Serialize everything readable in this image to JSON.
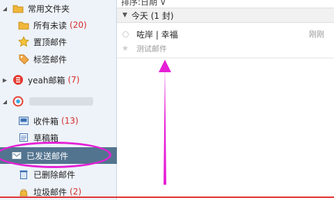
{
  "sidebar": {
    "common_folder": {
      "label": "常用文件夹"
    },
    "all_unread": {
      "label": "所有未读",
      "count": "(20)"
    },
    "pinned": {
      "label": "置顶邮件"
    },
    "tagged": {
      "label": "标签邮件"
    },
    "yeah_account": {
      "label": "yeah邮箱",
      "count": "(7)"
    },
    "account2": {},
    "inbox": {
      "label": "收件箱",
      "count": "(13)"
    },
    "drafts": {
      "label": "草稿箱"
    },
    "sent": {
      "label": "已发送邮件"
    },
    "deleted": {
      "label": "已删除邮件"
    },
    "junk": {
      "label": "垃圾邮件",
      "count": "(2)"
    }
  },
  "main": {
    "sort_label": "排序:日期 ∨",
    "group": {
      "label": "今天 (1 封)"
    },
    "mail": {
      "sender": "咗岸 | 幸福",
      "subject": "测试邮件",
      "time": "刚刚"
    }
  },
  "colors": {
    "annotation": "#e61fd6",
    "active_bg": "#53748f",
    "count_red": "#d52b2b"
  },
  "icons": [
    "folder-icon",
    "star-icon",
    "tag-icon",
    "netease-logo-icon",
    "account-logo-icon",
    "inbox-icon",
    "drafts-icon",
    "sent-icon",
    "trash-icon",
    "junk-icon"
  ]
}
